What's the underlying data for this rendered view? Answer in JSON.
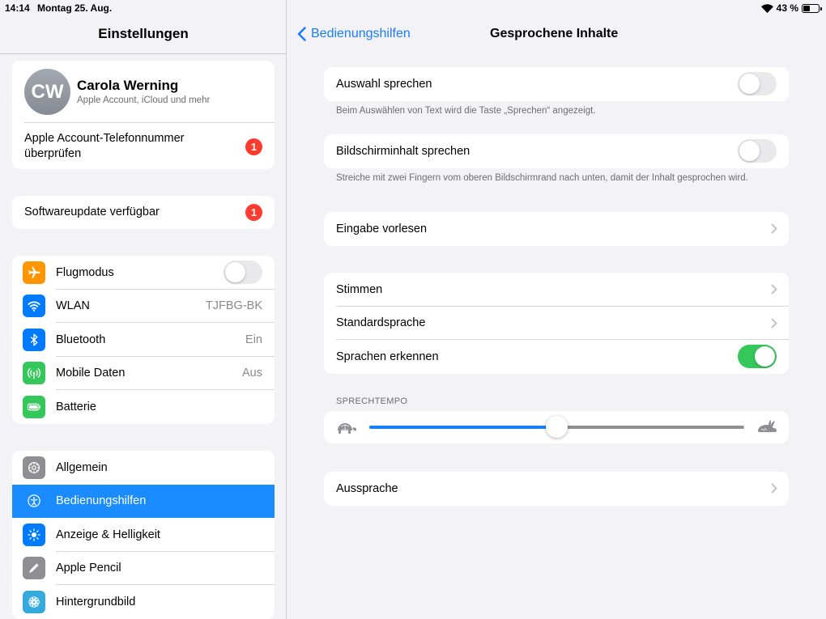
{
  "status_bar": {
    "time": "14:14",
    "date": "Montag 25. Aug.",
    "battery": "43 %",
    "battery_level": 0.43
  },
  "sidebar": {
    "title": "Einstellungen",
    "profile": {
      "initials": "CW",
      "name": "Carola Werning",
      "subtitle": "Apple Account, iCloud und mehr"
    },
    "phone_check": {
      "label": "Apple Account-Telefonnummer überprüfen",
      "badge": "1"
    },
    "software_update": {
      "label": "Softwareupdate verfügbar",
      "badge": "1"
    },
    "connectivity": [
      {
        "label": "Flugmodus",
        "icon": "airplane-icon",
        "color": "#ff9500",
        "toggle": false
      },
      {
        "label": "WLAN",
        "icon": "wifi-icon",
        "color": "#007aff",
        "value": "TJFBG-BK"
      },
      {
        "label": "Bluetooth",
        "icon": "bluetooth-icon",
        "color": "#007aff",
        "value": "Ein"
      },
      {
        "label": "Mobile Daten",
        "icon": "antenna-icon",
        "color": "#34c759",
        "value": "Aus"
      },
      {
        "label": "Batterie",
        "icon": "battery-icon",
        "color": "#34c759"
      }
    ],
    "general": [
      {
        "label": "Allgemein",
        "icon": "gear-icon",
        "color": "#8e8e93"
      },
      {
        "label": "Bedienungshilfen",
        "icon": "accessibility-icon",
        "color": "#1a8cff",
        "selected": true
      },
      {
        "label": "Anzeige & Helligkeit",
        "icon": "sun-icon",
        "color": "#007aff"
      },
      {
        "label": "Apple Pencil",
        "icon": "pencil-icon",
        "color": "#8e8e93"
      },
      {
        "label": "Hintergrundbild",
        "icon": "flower-icon",
        "color": "#35aadc"
      }
    ]
  },
  "detail": {
    "back_label": "Bedienungshilfen",
    "title": "Gesprochene Inhalte",
    "speak_selection": {
      "label": "Auswahl sprechen",
      "on": false,
      "footnote": "Beim Auswählen von Text wird die Taste „Sprechen“ angezeigt."
    },
    "speak_screen": {
      "label": "Bildschirminhalt sprechen",
      "on": false,
      "footnote": "Streiche mit zwei Fingern vom oberen Bildschirmrand nach unten, damit der Inhalt gesprochen wird."
    },
    "typing_feedback": {
      "label": "Eingabe vorlesen"
    },
    "voices_group": [
      {
        "label": "Stimmen",
        "type": "chevron"
      },
      {
        "label": "Standardsprache",
        "type": "chevron"
      },
      {
        "label": "Sprachen erkennen",
        "type": "toggle",
        "on": true
      }
    ],
    "rate": {
      "header": "SPRECHTEMPO",
      "value": 0.5
    },
    "pronunciations": {
      "label": "Aussprache"
    }
  },
  "colors": {
    "accent": "#1a7dfc",
    "selected": "#1a8cff",
    "toggle_on": "#34c759",
    "badge": "#ff3b30"
  }
}
